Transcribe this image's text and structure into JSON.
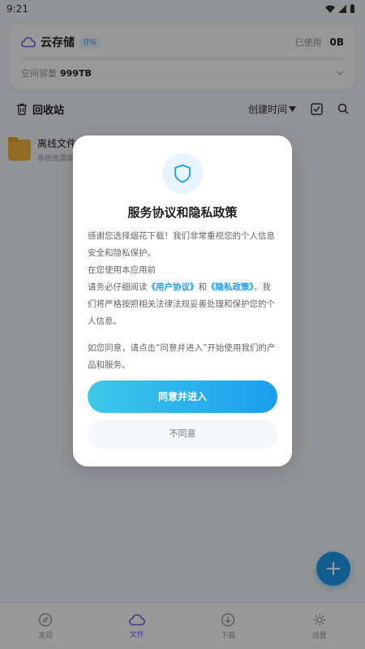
{
  "status": {
    "time": "9:21"
  },
  "storage": {
    "title": "云存储",
    "badge": "0%",
    "used_label": "已使用",
    "used_value": "0B",
    "capacity_label": "空间容量",
    "capacity_value": "999TB",
    "used_fraction": 0
  },
  "toolbar": {
    "recycle_label": "回收站",
    "sort_label": "创建时间"
  },
  "file": {
    "name": "离线文件",
    "sub": "系统资源库"
  },
  "fab": {
    "label": "+"
  },
  "nav": {
    "items": [
      {
        "label": "发现",
        "icon": "compass-icon"
      },
      {
        "label": "文件",
        "icon": "cloud-icon"
      },
      {
        "label": "下载",
        "icon": "download-icon"
      },
      {
        "label": "设置",
        "icon": "gear-icon"
      }
    ]
  },
  "dialog": {
    "title": "服务协议和隐私政策",
    "p1": "感谢您选择烟花下载！我们非常重视您的个人信息安全和隐私保护。",
    "p2": "在您使用本应用前",
    "p3_prefix": "请务必仔细阅读",
    "link_user": "《用户协议》",
    "and": "和",
    "link_privacy": "《隐私政策》",
    "p3_suffix": "。我们将严格按照相关法律法规妥善处理和保护您的个人信息。",
    "p4": "如您同意，请点击“同意并进入”开始使用我们的产品和服务。",
    "agree_label": "同意并进入",
    "disagree_label": "不同意"
  },
  "colors": {
    "accent": "#1e9cf0",
    "nav_active": "#6b5bf0",
    "folder": "#f2b53c"
  }
}
